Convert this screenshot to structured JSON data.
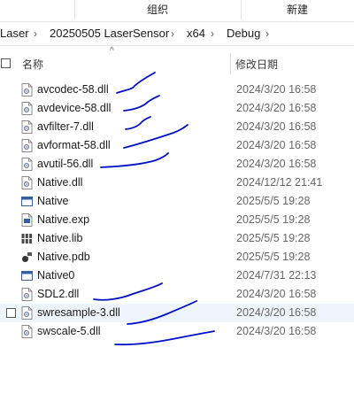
{
  "ribbon": {
    "organize": "组织",
    "new": "新建"
  },
  "breadcrumb": {
    "parts": [
      "Laser",
      "20250505 LaserSensor",
      "x64",
      "Debug"
    ]
  },
  "columns": {
    "name": "名称",
    "modified": "修改日期"
  },
  "colors": {
    "ink": "#0010c8",
    "selected_row": "#eef4fc",
    "date_text": "#666666"
  },
  "files": [
    {
      "name": "avcodec-58.dll",
      "date": "2024/3/20 16:58",
      "icon": "dll-icon"
    },
    {
      "name": "avdevice-58.dll",
      "date": "2024/3/20 16:58",
      "icon": "dll-icon"
    },
    {
      "name": "avfilter-7.dll",
      "date": "2024/3/20 16:58",
      "icon": "dll-icon"
    },
    {
      "name": "avformat-58.dll",
      "date": "2024/3/20 16:58",
      "icon": "dll-icon"
    },
    {
      "name": "avutil-56.dll",
      "date": "2024/3/20 16:58",
      "icon": "dll-icon"
    },
    {
      "name": "Native.dll",
      "date": "2024/12/12 21:41",
      "icon": "dll-icon"
    },
    {
      "name": "Native",
      "date": "2025/5/5 19:28",
      "icon": "application-icon"
    },
    {
      "name": "Native.exp",
      "date": "2025/5/5 19:28",
      "icon": "exp-file-icon"
    },
    {
      "name": "Native.lib",
      "date": "2025/5/5 19:28",
      "icon": "lib-file-icon"
    },
    {
      "name": "Native.pdb",
      "date": "2025/5/5 19:28",
      "icon": "pdb-file-icon"
    },
    {
      "name": "Native0",
      "date": "2024/7/31 22:13",
      "icon": "application-icon"
    },
    {
      "name": "SDL2.dll",
      "date": "2024/3/20 16:58",
      "icon": "dll-icon"
    },
    {
      "name": "swresample-3.dll",
      "date": "2024/3/20 16:58",
      "icon": "dll-icon"
    },
    {
      "name": "swscale-5.dll",
      "date": "2024/3/20 16:58",
      "icon": "dll-icon"
    }
  ]
}
